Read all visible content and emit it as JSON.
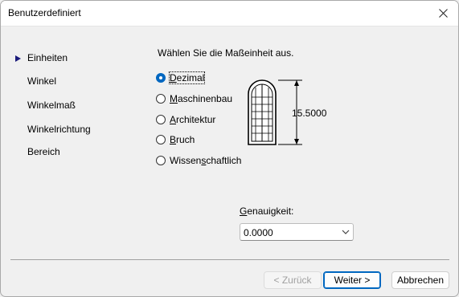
{
  "window": {
    "title": "Benutzerdefiniert"
  },
  "nav": {
    "items": [
      {
        "label": "Einheiten",
        "active": true
      },
      {
        "label": "Winkel"
      },
      {
        "label": "Winkelmaß"
      },
      {
        "label": "Winkelrichtung"
      },
      {
        "label": "Bereich"
      }
    ]
  },
  "units": {
    "prompt": "Wählen Sie die Maßeinheit aus.",
    "options": [
      {
        "label": "Dezimal",
        "mnemonic": "D",
        "rest": "ezimal",
        "checked": true
      },
      {
        "label": "Maschinenbau",
        "mnemonic": "M",
        "rest": "aschinenbau"
      },
      {
        "label": "Architektur",
        "mnemonic": "A",
        "rest": "rchitektur"
      },
      {
        "label": "Bruch",
        "mnemonic": "B",
        "rest": "ruch"
      },
      {
        "label": "Wissenschaftlich",
        "pre": "Wissen",
        "mnemonic": "s",
        "rest": "chaftlich"
      }
    ],
    "preview_dimension": "15.5000"
  },
  "precision": {
    "label": "Genauigkeit:",
    "value": "0.0000"
  },
  "buttons": {
    "back": "< Zurück",
    "next": "Weiter >",
    "cancel": "Abbrechen"
  },
  "colors": {
    "accent": "#0067c0",
    "nav_arrow": "#1a1a7a"
  }
}
